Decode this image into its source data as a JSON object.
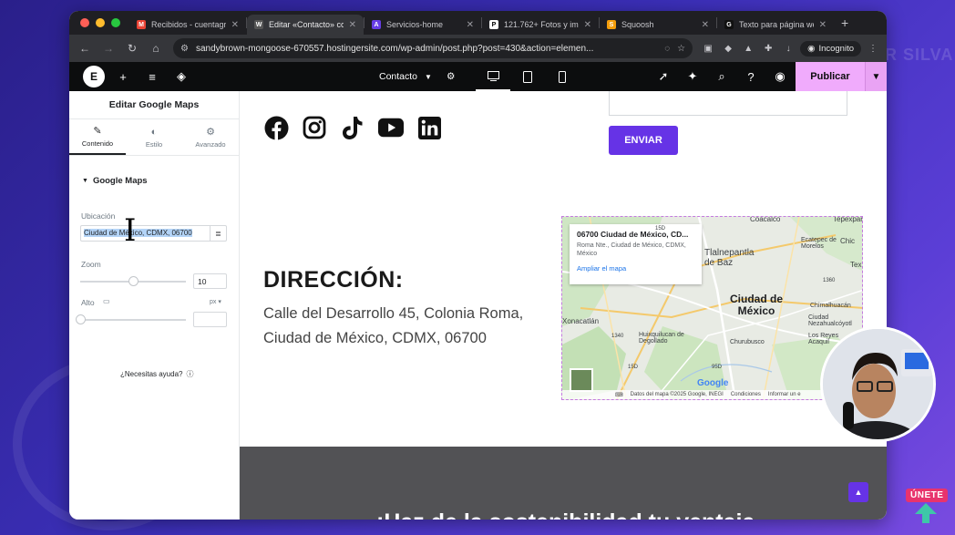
{
  "browser": {
    "tabs": [
      {
        "title": "Recibidos - cuentagr",
        "favicon": "gmail-icon",
        "color": "#ea4335",
        "glyph": "M",
        "active": false
      },
      {
        "title": "Editar «Contacto» co",
        "favicon": "wordpress-icon",
        "color": "#555",
        "glyph": "W",
        "active": true
      },
      {
        "title": "Servicios-home",
        "favicon": "hostinger-icon",
        "color": "#673de6",
        "glyph": "A",
        "active": false
      },
      {
        "title": "121.762+ Fotos y imá",
        "favicon": "pexels-icon",
        "color": "#fff",
        "glyph": "P",
        "active": false
      },
      {
        "title": "Squoosh",
        "favicon": "squoosh-icon",
        "color": "#f59e0b",
        "glyph": "S",
        "active": false
      },
      {
        "title": "Texto para página we",
        "favicon": "chatgpt-icon",
        "color": "#111",
        "glyph": "G",
        "active": false
      }
    ],
    "url": "sandybrown-mongoose-670557.hostingersite.com/wp-admin/post.php?post=430&action=elemen...",
    "incognito_label": "Incognito"
  },
  "editor": {
    "page_name": "Contacto",
    "publish_label": "Publicar"
  },
  "panel": {
    "title": "Editar Google Maps",
    "tabs": [
      {
        "label": "Contenido",
        "icon": "pencil-icon",
        "active": true
      },
      {
        "label": "Estilo",
        "icon": "half-circle-icon",
        "active": false
      },
      {
        "label": "Avanzado",
        "icon": "gear-icon",
        "active": false
      }
    ],
    "section_title": "Google Maps",
    "location_label": "Ubicación",
    "location_value": "Ciudad de México, CDMX, 06700",
    "zoom_label": "Zoom",
    "zoom_value": "10",
    "zoom_level": 10,
    "zoom_max": 20,
    "height_label": "Alto",
    "height_unit": "px",
    "help_text": "¿Necesitas ayuda?"
  },
  "canvas": {
    "submit_label": "ENVIAR",
    "address_title": "DIRECCIÓN:",
    "address_line1": "Calle del Desarrollo 45, Colonia Roma,",
    "address_line2": "Ciudad de México, CDMX, 06700",
    "band_heading": "¡Haz de la sostenibilidad tu ventaja",
    "social_icons": [
      "facebook-icon",
      "instagram-icon",
      "tiktok-icon",
      "youtube-icon",
      "linkedin-icon"
    ]
  },
  "map": {
    "card_title": "06700 Ciudad de México, CD...",
    "card_address": "Roma Nte., Ciudad de México, CDMX, México",
    "card_link": "Ampliar el mapa",
    "labels": {
      "coacalco": "Coacalco",
      "tepexpan": "Tepexpan",
      "ecatepec": "Ecatepec de Morelos",
      "tlalnepantla": "Tlalnepantla de Baz",
      "chic": "Chic",
      "tex": "Tex",
      "cdmx": "Ciudad de México",
      "chimalhuacan": "Chimalhuacán",
      "nezahualcoyotl": "Ciudad Nezahualcóyotl",
      "los_reyes": "Los Reyes Acaquil",
      "xonacatlan": "Xonacatlán",
      "huixquilucan": "Huixquilucan de Degollado",
      "churubusco": "Churubusco",
      "r1": "1360",
      "r2": "1340",
      "r3": "15D",
      "r4": "95D",
      "r5": "15D"
    },
    "footer": {
      "shortcuts": "Combinaciones de teclas",
      "data": "Datos del mapa ©2025 Google, INEGI",
      "terms": "Condiciones",
      "report": "Informar un e"
    },
    "brand": "Google"
  },
  "overlay": {
    "watermark": "OLIVER SILVA",
    "join_label": "ÚNETE"
  }
}
